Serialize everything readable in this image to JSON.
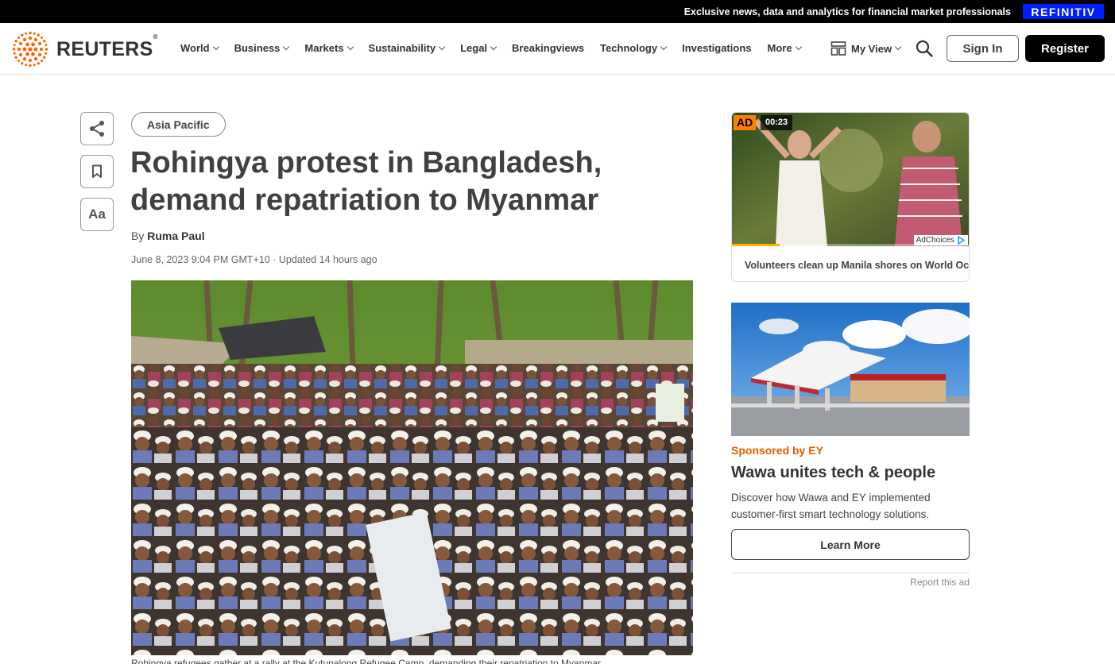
{
  "topbar": {
    "promo": "Exclusive news, data and analytics for financial market professionals",
    "partner_logo": "REFINITIV"
  },
  "header": {
    "logo_text": "REUTERS",
    "logo_reg": "®",
    "nav": [
      {
        "label": "World",
        "has_menu": true
      },
      {
        "label": "Business",
        "has_menu": true
      },
      {
        "label": "Markets",
        "has_menu": true
      },
      {
        "label": "Sustainability",
        "has_menu": true
      },
      {
        "label": "Legal",
        "has_menu": true
      },
      {
        "label": "Breakingviews",
        "has_menu": false
      },
      {
        "label": "Technology",
        "has_menu": true
      },
      {
        "label": "Investigations",
        "has_menu": false
      },
      {
        "label": "More",
        "has_menu": true
      }
    ],
    "myview_label": "My View",
    "signin_label": "Sign In",
    "register_label": "Register",
    "brand_color": "#fa6400"
  },
  "tools": {
    "share_icon": "share-icon",
    "bookmark_icon": "bookmark-icon",
    "text_size_label": "Aa"
  },
  "article": {
    "section_tag": "Asia Pacific",
    "headline": "Rohingya protest in Bangladesh, demand repatriation to Myanmar",
    "by_prefix": "By",
    "author": "Ruma Paul",
    "dateline": "June 8, 2023 9:04 PM GMT+10 · Updated 14 hours ago",
    "photo_alt": "crowd-photo",
    "caption": "Rohingya refugees gather at a rally at the Kutupalong Refugee Camp, demanding their repatriation to Myanmar"
  },
  "video_ad": {
    "ad_label": "AD",
    "time": "00:23",
    "progress": 0.2,
    "adchoices_label": "AdChoices",
    "title": "Volunteers clean up Manila shores on World Oceans Day"
  },
  "sponsored_ad": {
    "sponsored_label": "Sponsored by EY",
    "headline": "Wawa unites tech & people",
    "body": "Discover how Wawa and EY implemented customer-first smart technology solutions.",
    "cta_label": "Learn More",
    "report_label": "Report this ad",
    "sponsored_color": "#e35b00"
  }
}
